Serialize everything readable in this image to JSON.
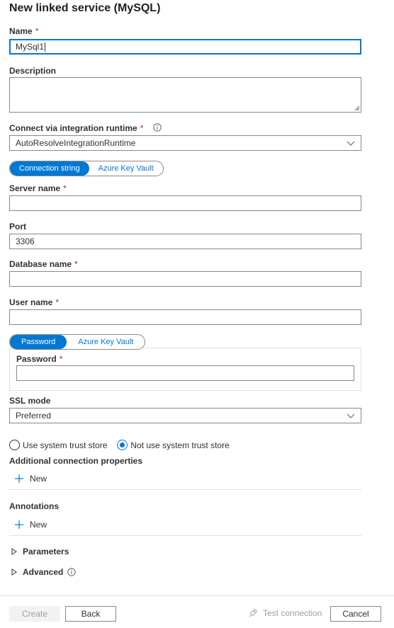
{
  "title": "New linked service (MySQL)",
  "name": {
    "label": "Name",
    "required": "*",
    "value": "MySql1"
  },
  "description": {
    "label": "Description",
    "value": ""
  },
  "runtime": {
    "label": "Connect via integration runtime",
    "required": "*",
    "value": "AutoResolveIntegrationRuntime"
  },
  "conn_toggle": {
    "options": [
      "Connection string",
      "Azure Key Vault"
    ],
    "selected": "Connection string"
  },
  "server": {
    "label": "Server name",
    "required": "*",
    "value": ""
  },
  "port": {
    "label": "Port",
    "value": "3306"
  },
  "database": {
    "label": "Database name",
    "required": "*",
    "value": ""
  },
  "user": {
    "label": "User name",
    "required": "*",
    "value": ""
  },
  "pw_toggle": {
    "options": [
      "Password",
      "Azure Key Vault"
    ],
    "selected": "Password"
  },
  "password": {
    "label": "Password",
    "required": "*",
    "value": ""
  },
  "ssl": {
    "label": "SSL mode",
    "value": "Preferred"
  },
  "trust": {
    "options": [
      "Use system trust store",
      "Not use system trust store"
    ],
    "selected": "Not use system trust store"
  },
  "additional": {
    "label": "Additional connection properties",
    "new_label": "New"
  },
  "annotations": {
    "label": "Annotations",
    "new_label": "New"
  },
  "parameters": {
    "label": "Parameters"
  },
  "advanced": {
    "label": "Advanced"
  },
  "footer": {
    "create": "Create",
    "back": "Back",
    "test_connection": "Test connection",
    "cancel": "Cancel"
  },
  "colors": {
    "accent": "#0078d4",
    "required": "#a4262c",
    "border": "#8a8886"
  }
}
